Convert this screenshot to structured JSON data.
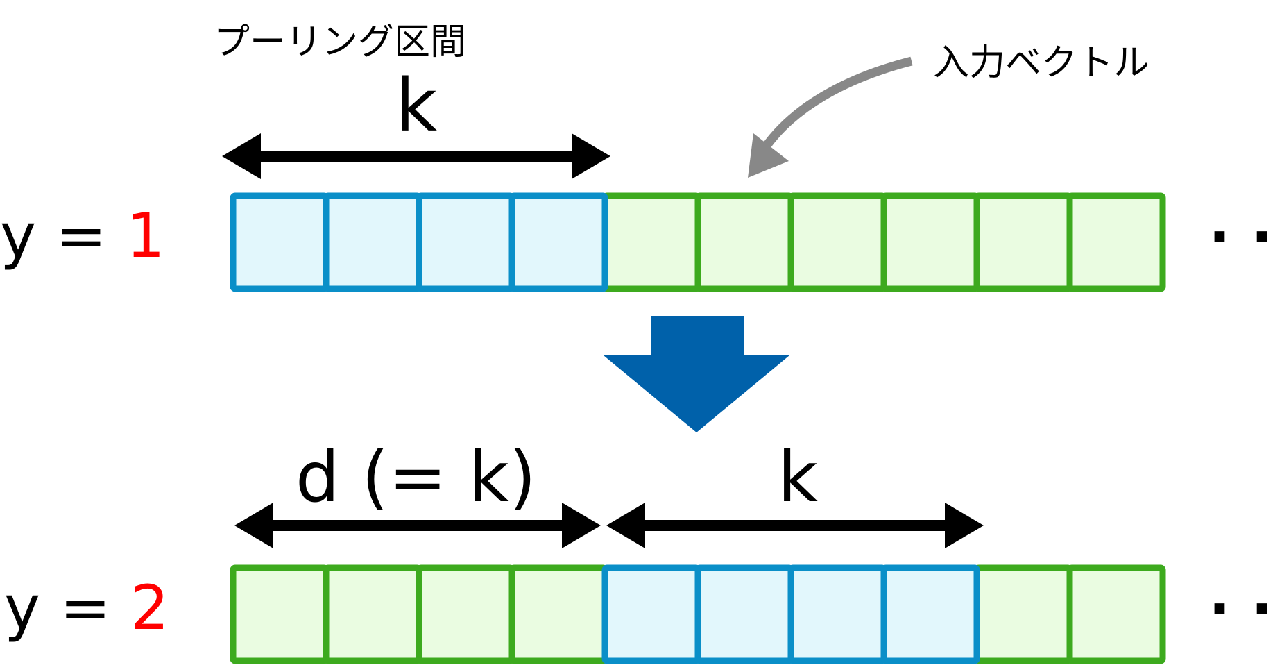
{
  "labels": {
    "pooling_interval": "プーリング区間",
    "k_top": "k",
    "input_vector": "入力ベクトル",
    "d_eq_k": "d (= k)",
    "k_bottom": "k",
    "row1_prefix": "y =",
    "row1_value": "1",
    "row2_prefix": "y =",
    "row2_value": "2",
    "ellipsis1": "· · ·",
    "ellipsis2": "· · ·"
  },
  "rows": [
    {
      "y": 1,
      "cells": 10,
      "highlight_start": 0,
      "highlight_count": 4
    },
    {
      "y": 2,
      "cells": 10,
      "highlight_start": 4,
      "highlight_count": 4
    }
  ],
  "colors": {
    "highlight_stroke": "#0A8FC8",
    "highlight_fill": "#E2F7FC",
    "normal_stroke": "#3DAA1E",
    "normal_fill": "#EAFCE1",
    "down_arrow": "#0061AA",
    "pointer_arrow": "#888888",
    "y_value": "#FF0000",
    "text": "#000000"
  }
}
